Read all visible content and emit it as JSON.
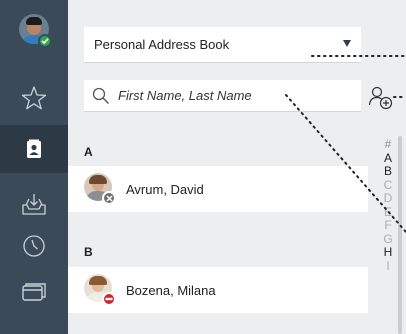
{
  "address_book": {
    "selected": "Personal Address Book"
  },
  "search": {
    "placeholder": "First Name, Last Name"
  },
  "sections": [
    {
      "letter": "A",
      "contacts": [
        {
          "name": "Avrum, David",
          "status": "offline"
        }
      ]
    },
    {
      "letter": "B",
      "contacts": [
        {
          "name": "Bozena, Milana",
          "status": "busy"
        }
      ]
    }
  ],
  "alphabet": [
    "#",
    "A",
    "B",
    "C",
    "D",
    "E",
    "F",
    "G",
    "H",
    "I"
  ],
  "colors": {
    "sidebar": "#3b4a58",
    "sidebar_active": "#2d3a46",
    "status_online": "#2fa84f",
    "status_offline": "#6f6f6f",
    "status_busy": "#d0262c"
  },
  "icons": {
    "sidebar": [
      "star-icon",
      "contacts-icon",
      "inbox-download-icon",
      "clock-icon",
      "chat-windows-icon"
    ],
    "add_contact": "add-contact-icon",
    "search": "search-icon"
  }
}
